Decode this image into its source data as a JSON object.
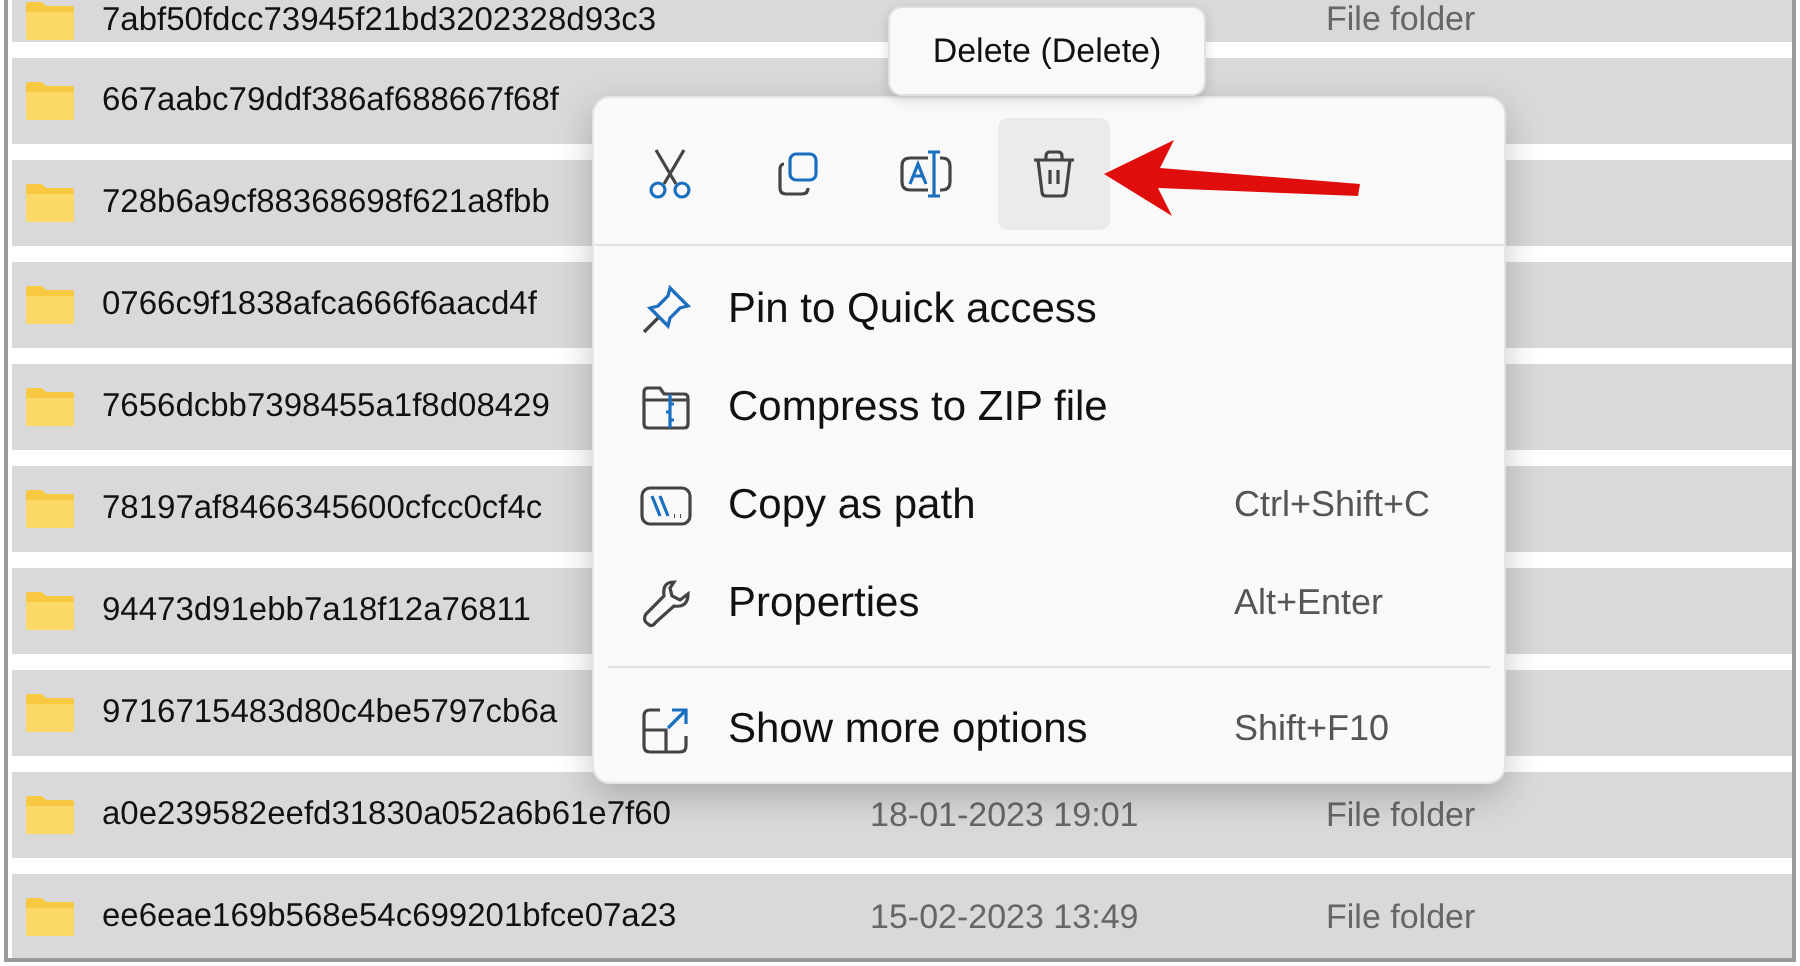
{
  "files": [
    {
      "name": "7abf50fdcc73945f21bd3202328d93c3",
      "type": "File folder"
    },
    {
      "name": "667aabc79ddf386af688667f68f"
    },
    {
      "name": "728b6a9cf88368698f621a8fbb"
    },
    {
      "name": "0766c9f1838afca666f6aacd4f"
    },
    {
      "name": "7656dcbb7398455a1f8d08429"
    },
    {
      "name": "78197af8466345600cfcc0cf4c"
    },
    {
      "name": "94473d91ebb7a18f12a76811"
    },
    {
      "name": "9716715483d80c4be5797cb6a"
    },
    {
      "name": "a0e239582eefd31830a052a6b61e7f60",
      "date": "18-01-2023 19:01",
      "type": "File folder"
    },
    {
      "name": "ee6eae169b568e54c699201bfce07a23",
      "date": "15-02-2023 13:49",
      "type": "File folder"
    }
  ],
  "tooltip": "Delete (Delete)",
  "context_menu": {
    "toolbar": [
      {
        "kind": "cut",
        "hovered": false
      },
      {
        "kind": "copy",
        "hovered": false
      },
      {
        "kind": "rename",
        "hovered": false
      },
      {
        "kind": "delete",
        "hovered": true
      }
    ],
    "groups": [
      [
        {
          "kind": "pin",
          "label": "Pin to Quick access"
        },
        {
          "kind": "zip",
          "label": "Compress to ZIP file"
        },
        {
          "kind": "path",
          "label": "Copy as path",
          "shortcut": "Ctrl+Shift+C"
        },
        {
          "kind": "properties",
          "label": "Properties",
          "shortcut": "Alt+Enter"
        }
      ],
      [
        {
          "kind": "more",
          "label": "Show more options",
          "shortcut": "Shift+F10"
        }
      ]
    ]
  }
}
